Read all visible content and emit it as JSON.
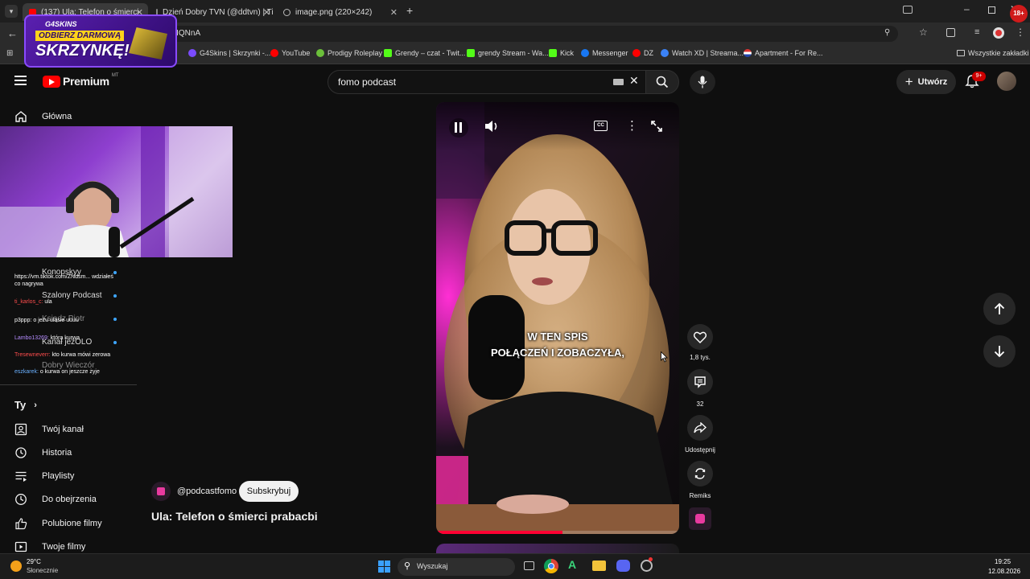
{
  "browser": {
    "tabs": [
      {
        "title": "(137) Ula: Telefon o śmierci",
        "active": true
      },
      {
        "title": "Dzień Dobry TVN (@ddtvn) | Ti",
        "active": false
      },
      {
        "title": "image.png (220×242)",
        "active": false
      }
    ],
    "new_tab": "+",
    "url_partial": "udIQNnA",
    "bookmarks": [
      {
        "label": "G4Skins | Skrzynki -...",
        "color": "#7a4bff"
      },
      {
        "label": "YouTube",
        "color": "#ff0000"
      },
      {
        "label": "Prodigy Roleplay",
        "color": "#6bbf3a"
      },
      {
        "label": "Grendy – czat - Twit...",
        "color": "#53fc18"
      },
      {
        "label": "grendy Stream - Wa...",
        "color": "#53fc18"
      },
      {
        "label": "Kick",
        "color": "#53fc18"
      },
      {
        "label": "Messenger",
        "color": "#1877f2"
      },
      {
        "label": "DZ",
        "color": "#ff0000"
      },
      {
        "label": "Watch XD | Streama...",
        "color": "#3b82f6"
      },
      {
        "label": "Apartment - For Re...",
        "color": "#ff4b4b"
      }
    ],
    "all_bookmarks": "Wszystkie zakładki",
    "badge_18": "18+"
  },
  "promo": {
    "brand": "G4SKINS",
    "line1": "ODBIERZ DARMOWĄ",
    "line2": "SKRZYNKĘ!"
  },
  "header": {
    "logo_text": "Premium",
    "logo_sup": "MT",
    "search_value": "fomo podcast",
    "create_label": "Utwórz",
    "notif_count": "9+"
  },
  "sidebar": {
    "home": "Główna",
    "subscriptions": [
      {
        "label": "Konopskyy"
      },
      {
        "label": "Szalony Podcast"
      },
      {
        "label": "Ksiądz Piotr"
      },
      {
        "label": "Kanał jeżOLO"
      },
      {
        "label": "Dobry Wieczór"
      }
    ],
    "you_header": "Ty",
    "you_items": [
      {
        "label": "Twój kanał",
        "icon": "channel-icon"
      },
      {
        "label": "Historia",
        "icon": "history-icon"
      },
      {
        "label": "Playlisty",
        "icon": "playlists-icon"
      },
      {
        "label": "Do obejrzenia",
        "icon": "watch-later-icon"
      },
      {
        "label": "Polubione filmy",
        "icon": "like-icon"
      },
      {
        "label": "Twoje filmy",
        "icon": "your-videos-icon"
      }
    ]
  },
  "chat": [
    {
      "user": "",
      "text": "https://vm.tiktok.com/ZNdsm... wdziałeś co nagrywa",
      "color": "#ffffff"
    },
    {
      "user": "ti_karlos_c:",
      "text": "ula",
      "color": "#ff4d4d"
    },
    {
      "user": "p3ppp:",
      "text": "o jezu ulasie uuuu",
      "color": "#ffffff"
    },
    {
      "user": "Lambo13269:",
      "text": "która kurwa",
      "color": "#b58cff"
    },
    {
      "user": "Tresewneverr:",
      "text": "kto kurwa mówi zerowa",
      "color": "#ff4d4d"
    },
    {
      "user": "eszkarek:",
      "text": "o kurwa on jeszcze żyje",
      "color": "#6ab0ff"
    }
  ],
  "short": {
    "channel": "@podcastfomo",
    "subscribe": "Subskrybuj",
    "title": "Ula: Telefon o śmierci prabacbi",
    "caption1": "W TEN SPIS",
    "caption2": "POŁĄCZEŃ I ZOBACZYŁA,",
    "progress": 0.52,
    "cc": "CC",
    "actions": {
      "likes": "1,8 tys.",
      "comments": "32",
      "share": "Udostępnij",
      "remix": "Remiks"
    }
  },
  "taskbar": {
    "temp": "29°C",
    "weather": "Słonecznie",
    "search": "Wyszukaj",
    "time": "19:25",
    "date": "12.08.2026"
  }
}
